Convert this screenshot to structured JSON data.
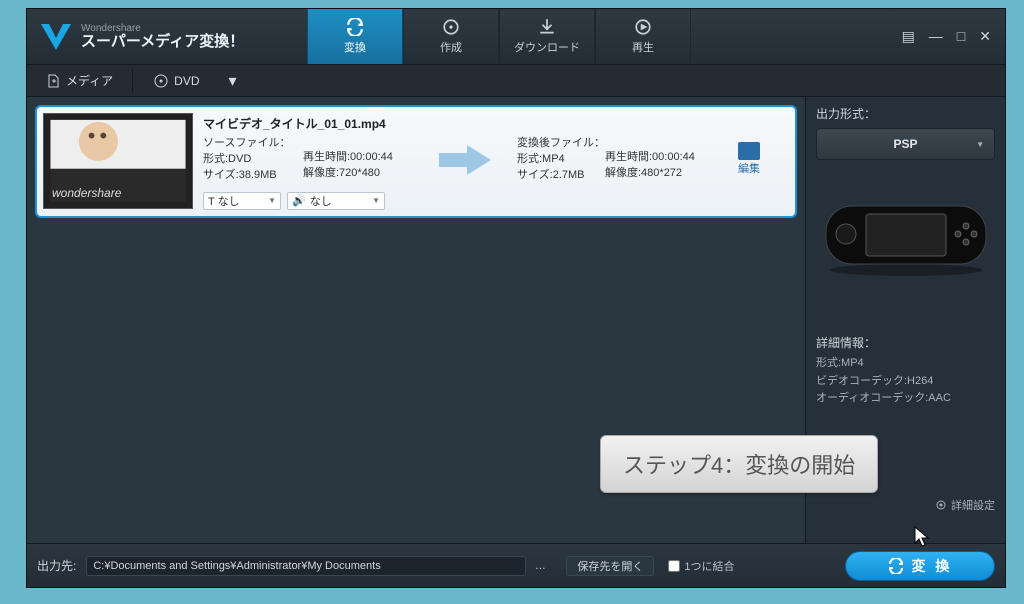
{
  "branding": {
    "company": "Wondershare",
    "product": "スーパーメディア変換！"
  },
  "top_tabs": {
    "convert": "変換",
    "create": "作成",
    "download": "ダウンロード",
    "play": "再生"
  },
  "toolbar": {
    "media": "メディア",
    "dvd": "DVD"
  },
  "file": {
    "title": "マイビデオ_タイトル_01_01.mp4",
    "source_header": "ソースファイル：",
    "format_src": "形式:DVD",
    "size_src": "サイズ:38.9MB",
    "duration_src": "再生時間:00:00:44",
    "res_src": "解像度:720*480",
    "after_header": "変換後ファイル：",
    "format_dst": "形式:MP4",
    "size_dst": "サイズ:2.7MB",
    "duration_dst": "再生時間:00:00:44",
    "res_dst": "解像度:480*272",
    "edit_label": "編集",
    "sub_none": "T なし",
    "aud_none": "なし",
    "thumb_wm": "wondershare"
  },
  "sidebar": {
    "outlabel": "出力形式：",
    "preset": "PSP",
    "details_label": "詳細情報：",
    "fmt": "形式:MP4",
    "vcodec": "ビデオコーデック:H264",
    "acodec": "オーディオコーデック:AAC",
    "advanced": "詳細設定"
  },
  "bottom": {
    "outto": "出力先:",
    "path": "C:¥Documents and Settings¥Administrator¥My Documents",
    "open": "保存先を開く",
    "merge": "1つに結合",
    "convert": "変 換"
  },
  "tooltip": "ステップ4：変換の開始"
}
